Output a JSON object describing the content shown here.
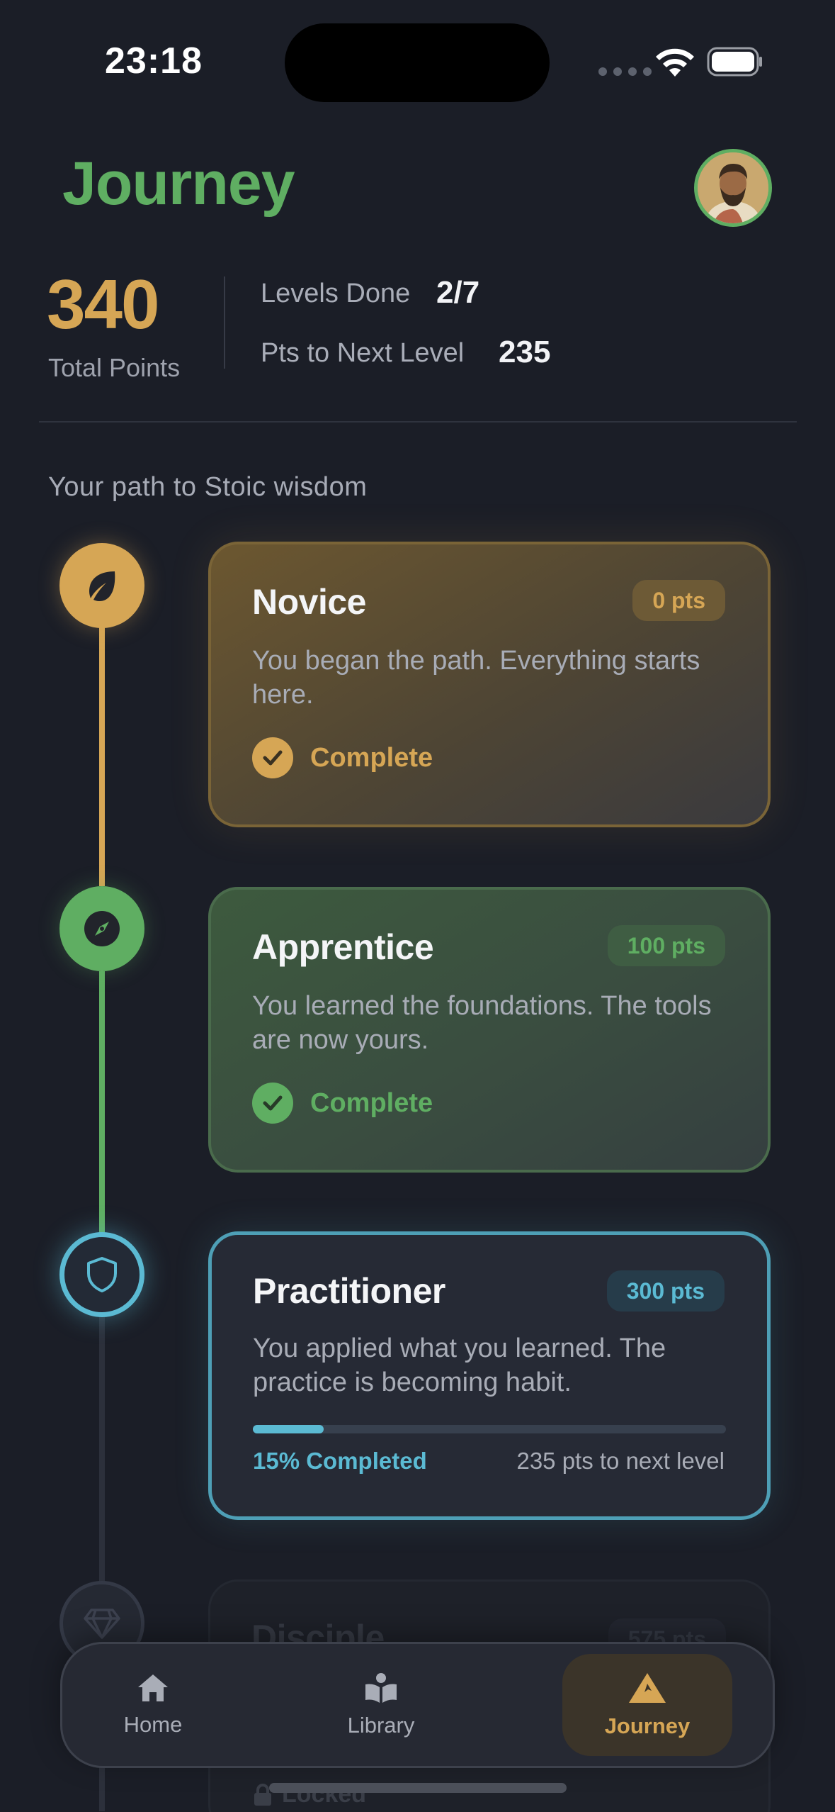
{
  "status_bar": {
    "time": "23:18"
  },
  "header": {
    "title": "Journey",
    "avatar_icon": "philosopher-avatar-icon"
  },
  "stats": {
    "total_points": "340",
    "total_points_label": "Total Points",
    "levels_done_label": "Levels Done",
    "levels_done_value": "2/7",
    "next_level_label": "Pts to Next Level",
    "next_level_value": "235"
  },
  "path_subtitle": "Your path to Stoic wisdom",
  "levels": [
    {
      "title": "Novice",
      "points": "0 pts",
      "description": "You began the path. Everything starts here.",
      "status": "Complete",
      "icon": "leaf-icon",
      "color": "#d6a655"
    },
    {
      "title": "Apprentice",
      "points": "100 pts",
      "description": "You learned the foundations. The tools are now yours.",
      "status": "Complete",
      "icon": "compass-icon",
      "color": "#5fae62"
    },
    {
      "title": "Practitioner",
      "points": "300 pts",
      "description": "You applied what you learned. The practice is becoming habit.",
      "progress_percent": 15,
      "progress_label": "15% Completed",
      "remaining": "235 pts to next level",
      "icon": "shield-icon",
      "color": "#5bbad3"
    },
    {
      "title": "Disciple",
      "points": "575 pts",
      "status": "Locked",
      "icon": "diamond-icon"
    }
  ],
  "nav": {
    "items": [
      {
        "label": "Home",
        "icon": "home-icon"
      },
      {
        "label": "Library",
        "icon": "book-reader-icon"
      },
      {
        "label": "Journey",
        "icon": "mountain-icon",
        "active": true
      }
    ]
  }
}
